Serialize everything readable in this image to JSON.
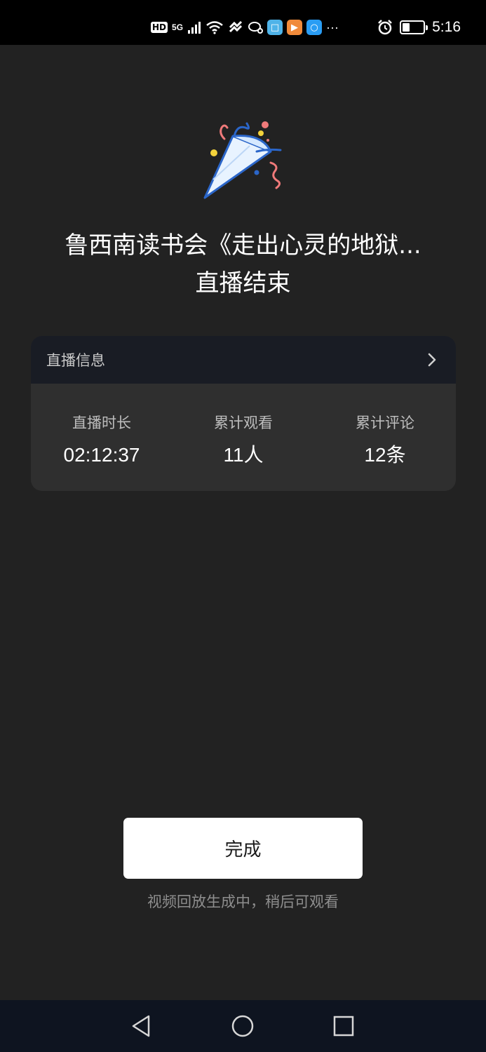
{
  "status_bar": {
    "network": "HD",
    "signal": "5G",
    "more": "···",
    "time": "5:16"
  },
  "live_end": {
    "title_line1": "鲁西南读书会《走出心灵的地狱...",
    "title_line2": "直播结束"
  },
  "info_card": {
    "header": "直播信息",
    "stats": [
      {
        "label": "直播时长",
        "value": "02:12:37"
      },
      {
        "label": "累计观看",
        "value": "11人"
      },
      {
        "label": "累计评论",
        "value": "12条"
      }
    ]
  },
  "done_button": "完成",
  "hint": "视频回放生成中，稍后可观看",
  "colors": {
    "background": "#222222",
    "card": "#2f2f2f",
    "card_header": "#191c24",
    "button": "#ffffff",
    "nav_bar": "#0e1420"
  },
  "icons": {
    "header_chevron": "chevron-right-icon",
    "celebration": "party-popper-icon",
    "nav": [
      "back-triangle-icon",
      "home-circle-icon",
      "recents-square-icon"
    ]
  }
}
